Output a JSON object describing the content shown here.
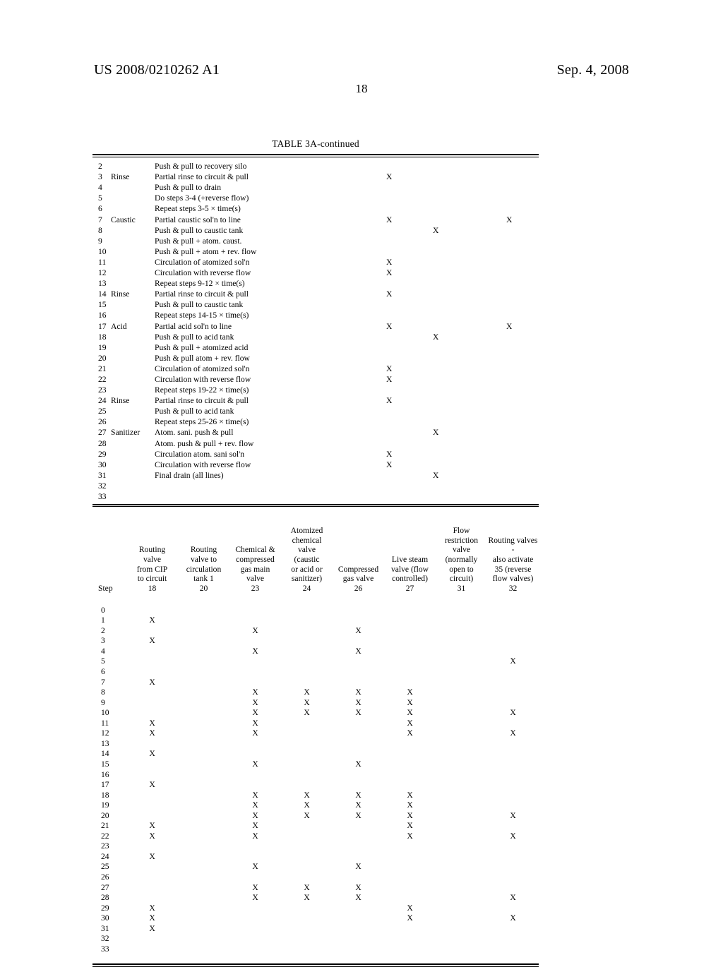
{
  "header": {
    "publication_number": "US 2008/0210262 A1",
    "publication_date": "Sep. 4, 2008",
    "page_number": "18"
  },
  "table_3a_continued": {
    "caption_prefix": "TABLE ",
    "caption_bold": "3A",
    "caption_suffix": "-continued",
    "caption_full": "TABLE 3A-continued",
    "rows": [
      {
        "step": "2",
        "phase": "",
        "description": "Push & pull to recovery silo",
        "m1": "",
        "m2": "",
        "m3": ""
      },
      {
        "step": "3",
        "phase": "Rinse",
        "description": "Partial rinse to circuit & pull",
        "m1": "X",
        "m2": "",
        "m3": ""
      },
      {
        "step": "4",
        "phase": "",
        "description": "Push & pull to drain",
        "m1": "",
        "m2": "",
        "m3": ""
      },
      {
        "step": "5",
        "phase": "",
        "description": "Do steps 3-4 (+reverse flow)",
        "m1": "",
        "m2": "",
        "m3": ""
      },
      {
        "step": "6",
        "phase": "",
        "description": "Repeat steps 3-5 × time(s)",
        "m1": "",
        "m2": "",
        "m3": ""
      },
      {
        "step": "7",
        "phase": "Caustic",
        "description": "Partial caustic sol'n to line",
        "m1": "X",
        "m2": "",
        "m3": "X"
      },
      {
        "step": "8",
        "phase": "",
        "description": "Push & pull to caustic tank",
        "m1": "",
        "m2": "X",
        "m3": ""
      },
      {
        "step": "9",
        "phase": "",
        "description": "Push & pull + atom. caust.",
        "m1": "",
        "m2": "",
        "m3": ""
      },
      {
        "step": "10",
        "phase": "",
        "description": "Push & pull + atom + rev. flow",
        "m1": "",
        "m2": "",
        "m3": ""
      },
      {
        "step": "11",
        "phase": "",
        "description": "Circulation of atomized sol'n",
        "m1": "X",
        "m2": "",
        "m3": ""
      },
      {
        "step": "12",
        "phase": "",
        "description": "Circulation with reverse flow",
        "m1": "X",
        "m2": "",
        "m3": ""
      },
      {
        "step": "13",
        "phase": "",
        "description": "Repeat steps 9-12 × time(s)",
        "m1": "",
        "m2": "",
        "m3": ""
      },
      {
        "step": "14",
        "phase": "Rinse",
        "description": "Partial rinse to circuit & pull",
        "m1": "X",
        "m2": "",
        "m3": ""
      },
      {
        "step": "15",
        "phase": "",
        "description": "Push & pull to caustic tank",
        "m1": "",
        "m2": "",
        "m3": ""
      },
      {
        "step": "16",
        "phase": "",
        "description": "Repeat steps 14-15 × time(s)",
        "m1": "",
        "m2": "",
        "m3": ""
      },
      {
        "step": "17",
        "phase": "Acid",
        "description": "Partial acid sol'n to line",
        "m1": "X",
        "m2": "",
        "m3": "X"
      },
      {
        "step": "18",
        "phase": "",
        "description": "Push & pull to acid tank",
        "m1": "",
        "m2": "X",
        "m3": ""
      },
      {
        "step": "19",
        "phase": "",
        "description": "Push & pull + atomized acid",
        "m1": "",
        "m2": "",
        "m3": ""
      },
      {
        "step": "20",
        "phase": "",
        "description": "Push & pull atom + rev. flow",
        "m1": "",
        "m2": "",
        "m3": ""
      },
      {
        "step": "21",
        "phase": "",
        "description": "Circulation of atomized sol'n",
        "m1": "X",
        "m2": "",
        "m3": ""
      },
      {
        "step": "22",
        "phase": "",
        "description": "Circulation with reverse flow",
        "m1": "X",
        "m2": "",
        "m3": ""
      },
      {
        "step": "23",
        "phase": "",
        "description": "Repeat steps 19-22 × time(s)",
        "m1": "",
        "m2": "",
        "m3": ""
      },
      {
        "step": "24",
        "phase": "Rinse",
        "description": "Partial rinse to circuit & pull",
        "m1": "X",
        "m2": "",
        "m3": ""
      },
      {
        "step": "25",
        "phase": "",
        "description": "Push & pull to acid tank",
        "m1": "",
        "m2": "",
        "m3": ""
      },
      {
        "step": "26",
        "phase": "",
        "description": "Repeat steps 25-26 × time(s)",
        "m1": "",
        "m2": "",
        "m3": ""
      },
      {
        "step": "27",
        "phase": "Sanitizer",
        "description": "Atom. sani. push & pull",
        "m1": "",
        "m2": "X",
        "m3": ""
      },
      {
        "step": "28",
        "phase": "",
        "description": "Atom. push & pull + rev. flow",
        "m1": "",
        "m2": "",
        "m3": ""
      },
      {
        "step": "29",
        "phase": "",
        "description": "Circulation atom. sani sol'n",
        "m1": "X",
        "m2": "",
        "m3": ""
      },
      {
        "step": "30",
        "phase": "",
        "description": "Circulation with reverse flow",
        "m1": "X",
        "m2": "",
        "m3": ""
      },
      {
        "step": "31",
        "phase": "",
        "description": "Final drain (all lines)",
        "m1": "",
        "m2": "X",
        "m3": ""
      },
      {
        "step": "32",
        "phase": "",
        "description": "",
        "m1": "",
        "m2": "",
        "m3": ""
      },
      {
        "step": "33",
        "phase": "",
        "description": "",
        "m1": "",
        "m2": "",
        "m3": ""
      }
    ]
  },
  "valve_table": {
    "step_header": "Step",
    "columns": [
      {
        "lines": [
          "Routing",
          "valve",
          "from CIP",
          "to circuit"
        ],
        "number": "18"
      },
      {
        "lines": [
          "Routing",
          "valve to",
          "circulation",
          "tank 1"
        ],
        "number": "20"
      },
      {
        "lines": [
          "Chemical &",
          "compressed",
          "gas main",
          "valve"
        ],
        "number": "23"
      },
      {
        "lines": [
          "Atomized",
          "chemical",
          "valve",
          "(caustic",
          "or acid or",
          "sanitizer)"
        ],
        "number": "24"
      },
      {
        "lines": [
          "Compressed",
          "gas valve"
        ],
        "number": "26"
      },
      {
        "lines": [
          "Live steam",
          "valve (flow",
          "controlled)"
        ],
        "number": "27"
      },
      {
        "lines": [
          "Flow restriction",
          "valve (normally",
          "open to",
          "circuit)"
        ],
        "number": "31"
      },
      {
        "lines": [
          "Routing valves -",
          "also activate",
          "35 (reverse",
          "flow valves)"
        ],
        "number": "32"
      }
    ],
    "rows": [
      {
        "step": "0",
        "marks": [
          "",
          "",
          "",
          "",
          "",
          "",
          "",
          ""
        ]
      },
      {
        "step": "1",
        "marks": [
          "X",
          "",
          "",
          "",
          "",
          "",
          "",
          ""
        ]
      },
      {
        "step": "2",
        "marks": [
          "",
          "",
          "X",
          "",
          "X",
          "",
          "",
          ""
        ]
      },
      {
        "step": "3",
        "marks": [
          "X",
          "",
          "",
          "",
          "",
          "",
          "",
          ""
        ]
      },
      {
        "step": "4",
        "marks": [
          "",
          "",
          "X",
          "",
          "X",
          "",
          "",
          ""
        ]
      },
      {
        "step": "5",
        "marks": [
          "",
          "",
          "",
          "",
          "",
          "",
          "",
          "X"
        ]
      },
      {
        "step": "6",
        "marks": [
          "",
          "",
          "",
          "",
          "",
          "",
          "",
          ""
        ]
      },
      {
        "step": "7",
        "marks": [
          "X",
          "",
          "",
          "",
          "",
          "",
          "",
          ""
        ]
      },
      {
        "step": "8",
        "marks": [
          "",
          "",
          "X",
          "X",
          "X",
          "X",
          "",
          ""
        ]
      },
      {
        "step": "9",
        "marks": [
          "",
          "",
          "X",
          "X",
          "X",
          "X",
          "",
          ""
        ]
      },
      {
        "step": "10",
        "marks": [
          "",
          "",
          "X",
          "X",
          "X",
          "X",
          "",
          "X"
        ]
      },
      {
        "step": "11",
        "marks": [
          "X",
          "",
          "X",
          "",
          "",
          "X",
          "",
          ""
        ]
      },
      {
        "step": "12",
        "marks": [
          "X",
          "",
          "X",
          "",
          "",
          "X",
          "",
          "X"
        ]
      },
      {
        "step": "13",
        "marks": [
          "",
          "",
          "",
          "",
          "",
          "",
          "",
          ""
        ]
      },
      {
        "step": "14",
        "marks": [
          "X",
          "",
          "",
          "",
          "",
          "",
          "",
          ""
        ]
      },
      {
        "step": "15",
        "marks": [
          "",
          "",
          "X",
          "",
          "X",
          "",
          "",
          ""
        ]
      },
      {
        "step": "16",
        "marks": [
          "",
          "",
          "",
          "",
          "",
          "",
          "",
          ""
        ]
      },
      {
        "step": "17",
        "marks": [
          "X",
          "",
          "",
          "",
          "",
          "",
          "",
          ""
        ]
      },
      {
        "step": "18",
        "marks": [
          "",
          "",
          "X",
          "X",
          "X",
          "X",
          "",
          ""
        ]
      },
      {
        "step": "19",
        "marks": [
          "",
          "",
          "X",
          "X",
          "X",
          "X",
          "",
          ""
        ]
      },
      {
        "step": "20",
        "marks": [
          "",
          "",
          "X",
          "X",
          "X",
          "X",
          "",
          "X"
        ]
      },
      {
        "step": "21",
        "marks": [
          "X",
          "",
          "X",
          "",
          "",
          "X",
          "",
          ""
        ]
      },
      {
        "step": "22",
        "marks": [
          "X",
          "",
          "X",
          "",
          "",
          "X",
          "",
          "X"
        ]
      },
      {
        "step": "23",
        "marks": [
          "",
          "",
          "",
          "",
          "",
          "",
          "",
          ""
        ]
      },
      {
        "step": "24",
        "marks": [
          "X",
          "",
          "",
          "",
          "",
          "",
          "",
          ""
        ]
      },
      {
        "step": "25",
        "marks": [
          "",
          "",
          "X",
          "",
          "X",
          "",
          "",
          ""
        ]
      },
      {
        "step": "26",
        "marks": [
          "",
          "",
          "",
          "",
          "",
          "",
          "",
          ""
        ]
      },
      {
        "step": "27",
        "marks": [
          "",
          "",
          "X",
          "X",
          "X",
          "",
          "",
          ""
        ]
      },
      {
        "step": "28",
        "marks": [
          "",
          "",
          "X",
          "X",
          "X",
          "",
          "",
          "X"
        ]
      },
      {
        "step": "29",
        "marks": [
          "X",
          "",
          "",
          "",
          "",
          "X",
          "",
          ""
        ]
      },
      {
        "step": "30",
        "marks": [
          "X",
          "",
          "",
          "",
          "",
          "X",
          "",
          "X"
        ]
      },
      {
        "step": "31",
        "marks": [
          "X",
          "",
          "",
          "",
          "",
          "",
          "",
          ""
        ]
      },
      {
        "step": "32",
        "marks": [
          "",
          "",
          "",
          "",
          "",
          "",
          "",
          ""
        ]
      },
      {
        "step": "33",
        "marks": [
          "",
          "",
          "",
          "",
          "",
          "",
          "",
          ""
        ]
      }
    ]
  }
}
